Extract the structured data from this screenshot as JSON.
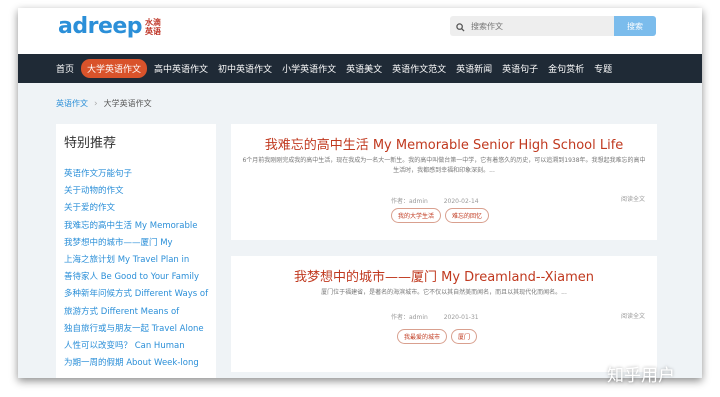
{
  "header": {
    "logo": "adreep",
    "logo_sub_1": "水滴",
    "logo_sub_2": "英语",
    "search_placeholder": "搜索作文",
    "search_button": "搜索"
  },
  "nav": {
    "items": [
      {
        "label": "首页"
      },
      {
        "label": "大学英语作文"
      },
      {
        "label": "高中英语作文"
      },
      {
        "label": "初中英语作文"
      },
      {
        "label": "小学英语作文"
      },
      {
        "label": "英语美文"
      },
      {
        "label": "英语作文范文"
      },
      {
        "label": "英语新闻"
      },
      {
        "label": "英语句子"
      },
      {
        "label": "金句赏析"
      },
      {
        "label": "专题"
      }
    ],
    "active_index": 1,
    "active_color": "#d9532b"
  },
  "breadcrumb": {
    "root": "英语作文",
    "current": "大学英语作文"
  },
  "sidebar": {
    "title": "特别推荐",
    "items": [
      {
        "label": "英语作文万能句子"
      },
      {
        "label": "关于动物的作文"
      },
      {
        "label": "关于爱的作文"
      },
      {
        "label": "我难忘的高中生活 My Memorable"
      },
      {
        "label": "我梦想中的城市——厦门 My"
      },
      {
        "label": "上海之旅计划 My Travel Plan in"
      },
      {
        "label": "善待家人 Be Good to Your Family"
      },
      {
        "label": "多种新年问候方式 Different Ways of"
      },
      {
        "label": "旅游方式 Different Means of"
      },
      {
        "label": "独自旅行或与朋友一起 Travel Alone"
      },
      {
        "label": "人性可以改变吗？  Can Human"
      },
      {
        "label": "为期一周的假期 About Week-long"
      }
    ]
  },
  "articles": [
    {
      "title": "我难忘的高中生活 My Memorable Senior High School Life",
      "excerpt": "6个月前我刚刚完成我的高中生活，现在我成为一名大一新生。我的高中叫做台第一中学，它有着悠久的历史，可以追溯到1938年。我想起我难忘的高中生活时，我都感到幸福和印象深刻。...",
      "author": "作者：admin",
      "date": "2020-02-14",
      "read_more": "阅读全文",
      "tags": [
        "我的大学生活",
        "难忘的回忆"
      ]
    },
    {
      "title": "我梦想中的城市——厦门 My Dreamland--Xiamen",
      "excerpt": "厦门位于福建省，是著名的海滨城市。它不仅以其自然美而闻名，而且以其现代化而闻名。...",
      "author": "作者：admin",
      "date": "2020-01-31",
      "read_more": "阅读全文",
      "tags": [
        "我最爱的城市",
        "厦门"
      ]
    }
  ],
  "watermark": "知乎用户",
  "colors": {
    "brand": "#2b8fd8",
    "title_red": "#c0391f",
    "nav_bg": "#1f2a36",
    "page_bg": "#eff3f6"
  }
}
